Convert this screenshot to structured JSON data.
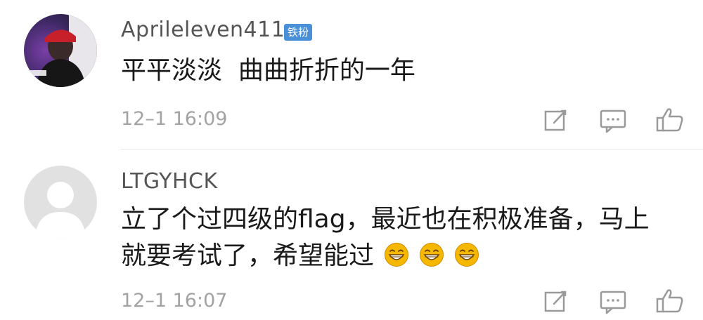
{
  "comments": [
    {
      "username": "Aprileleven411",
      "badge": "铁粉",
      "content": "平平淡淡  曲曲折折的一年",
      "timestamp": "12–1 16:09",
      "icons": [
        "edit-icon",
        "comment-icon",
        "thumbs-up-icon"
      ]
    },
    {
      "username": "LTGYHCK",
      "content_line1": "立了个过四级的flag，最近也在积极准备，马上",
      "content_line2": "就要考试了，希望能过",
      "emoji_count": 3,
      "emoji_name": "grin-emoji",
      "timestamp": "12–1 16:07",
      "icons": [
        "edit-icon",
        "comment-icon",
        "thumbs-up-icon"
      ]
    }
  ],
  "colors": {
    "badge": "#4a90d9",
    "username": "#555555",
    "content": "#1a1a1a",
    "timestamp": "#a3a3a3",
    "icon": "#9a9a9a",
    "emoji": "#f5b800"
  }
}
